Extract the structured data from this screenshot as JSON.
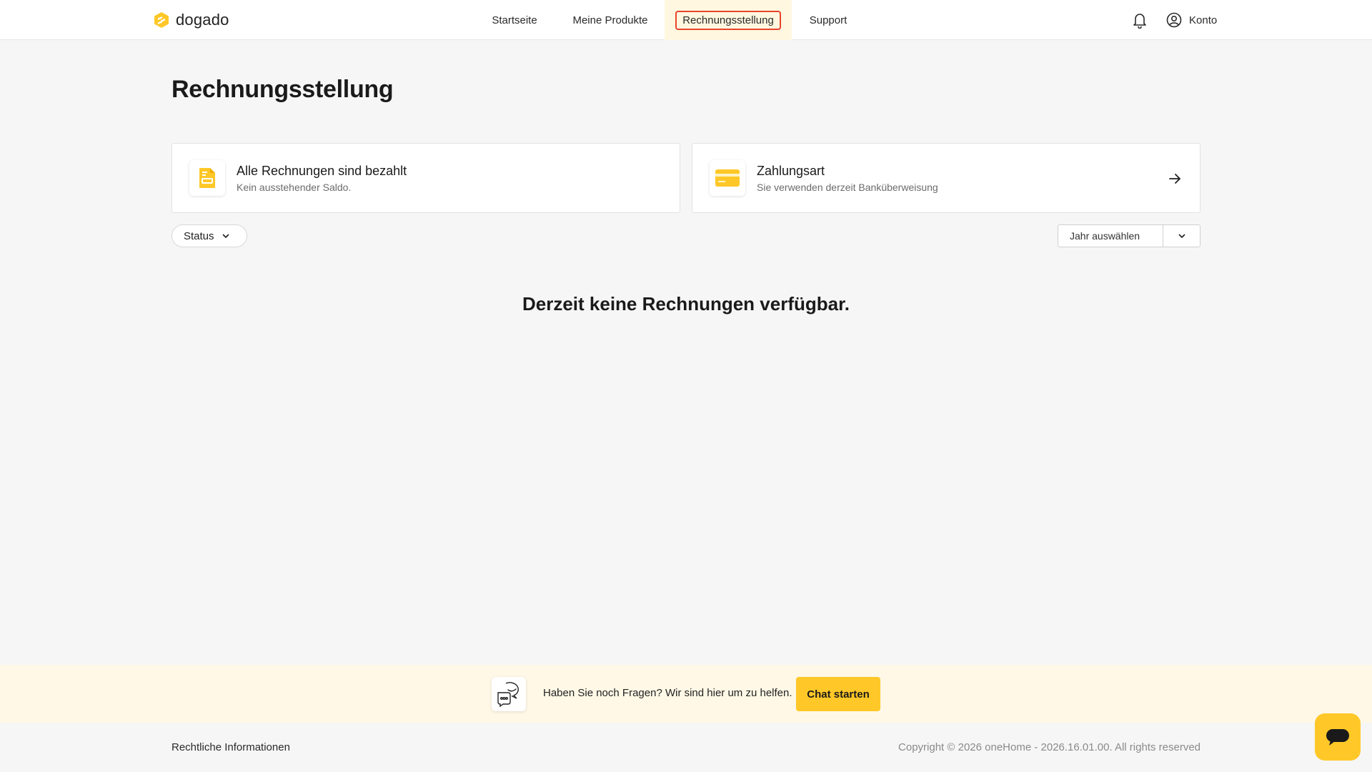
{
  "brand": {
    "name": "dogado",
    "accent": "#ffc828",
    "active_nav_outline": "#e8452c"
  },
  "nav": {
    "items": [
      {
        "label": "Startseite"
      },
      {
        "label": "Meine Produkte"
      },
      {
        "label": "Rechnungsstellung",
        "active": true
      },
      {
        "label": "Support"
      }
    ]
  },
  "header": {
    "bell_icon": "bell-icon",
    "account_label": "Konto",
    "account_icon": "user-circle-icon"
  },
  "main": {
    "title": "Rechnungsstellung",
    "cards": [
      {
        "title": "Alle Rechnungen sind bezahlt",
        "subtitle": "Kein ausstehender Saldo.",
        "icon": "invoice-document-icon"
      },
      {
        "title": "Zahlungsart",
        "subtitle": "Sie verwenden derzeit Banküberweisung",
        "icon": "credit-card-icon"
      }
    ],
    "filters": {
      "status_label": "Status",
      "year_placeholder": "Jahr auswählen"
    },
    "empty_message": "Derzeit keine Rechnungen verfügbar."
  },
  "help": {
    "text": "Haben Sie noch Fragen? Wir sind hier um zu helfen.",
    "button": "Chat starten"
  },
  "footer": {
    "legal_link": "Rechtliche Informationen",
    "copyright": "Copyright © 2026 oneHome - 2026.16.01.00. All rights reserved"
  }
}
